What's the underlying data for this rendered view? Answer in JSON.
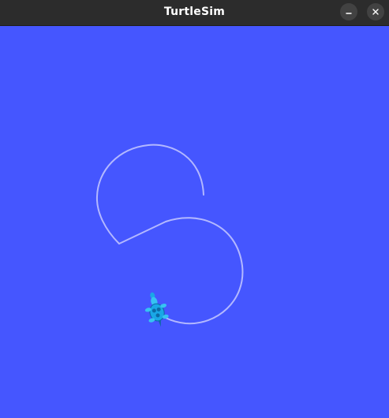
{
  "window": {
    "title": "TurtleSim",
    "buttons": [
      {
        "name": "minimize",
        "icon": "minimize-icon"
      },
      {
        "name": "close",
        "icon": "close-icon"
      }
    ]
  },
  "canvas": {
    "background_color": "#4556ff",
    "pen_color": "#b3b8ff",
    "turtle_color": "#1aa7e6",
    "turtle": {
      "icon": "turtle-icon"
    }
  }
}
